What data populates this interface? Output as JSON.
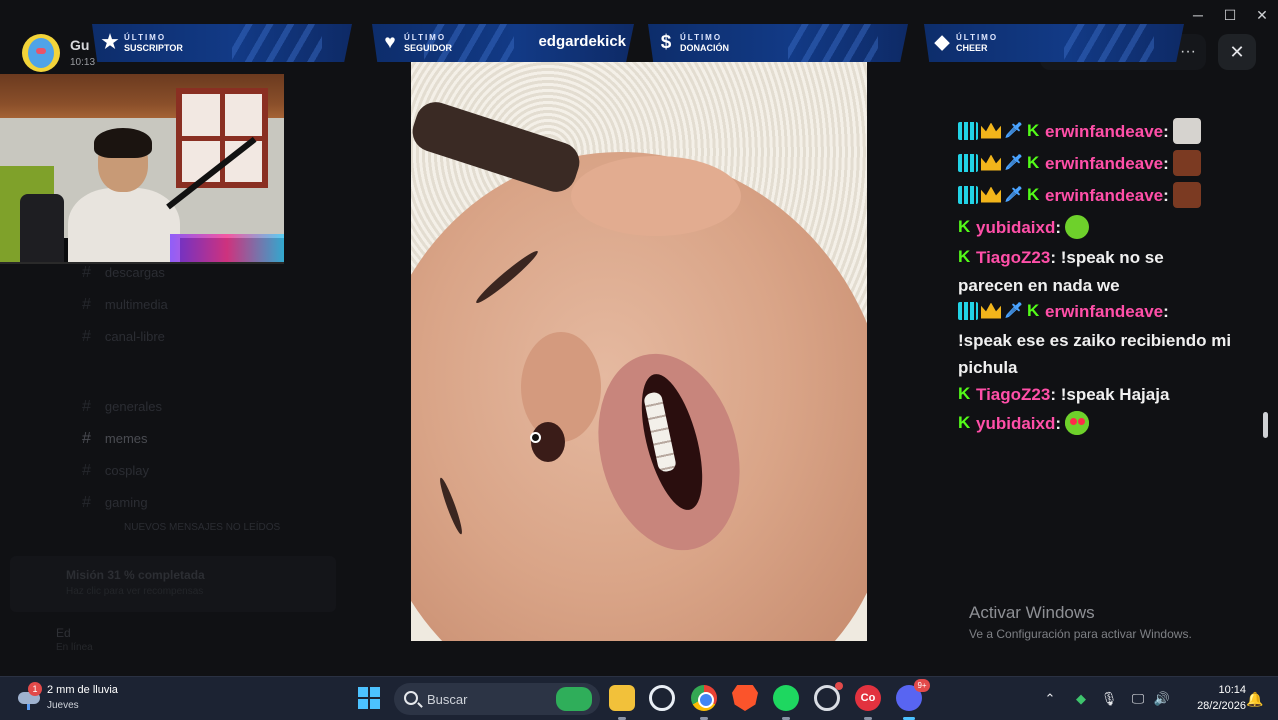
{
  "discord": {
    "server_name": "Gu",
    "server_time": "10:13",
    "channels": [
      {
        "label": "descargas"
      },
      {
        "label": "multimedia"
      },
      {
        "label": "canal-libre"
      },
      {
        "label": "generales"
      },
      {
        "label": "memes"
      },
      {
        "label": "cosplay"
      },
      {
        "label": "gaming"
      }
    ],
    "unread_label": "NUEVOS MENSAJES NO LEÍDOS",
    "mission_title": "Misión 31 % completada",
    "mission_sub": "Haz clic para ver recompensas",
    "user_name": "Ed",
    "user_status": "En línea"
  },
  "overlay": {
    "banners": [
      {
        "icon": "star-icon",
        "line1": "ÚLTIMO",
        "line2": "SUSCRIPTOR",
        "value": ""
      },
      {
        "icon": "heart-icon",
        "line1": "ÚLTIMO",
        "line2": "SEGUIDOR",
        "value": "edgardekick"
      },
      {
        "icon": "dollar-icon",
        "line1": "ÚLTIMO",
        "line2": "DONACIÓN",
        "value": ""
      },
      {
        "icon": "diamond-icon",
        "line1": "ÚLTIMO",
        "line2": "CHEER",
        "value": ""
      }
    ]
  },
  "viewer": {
    "more_label": "···",
    "close_label": "✕"
  },
  "chat": {
    "messages": [
      {
        "user": "erwinfandeave",
        "text": "",
        "emote": "cat-emote"
      },
      {
        "user": "erwinfandeave",
        "text": "",
        "emote": "man-emote"
      },
      {
        "user": "erwinfandeave",
        "text": "",
        "emote": "man-emote"
      },
      {
        "user": "yubidaixd",
        "text": "",
        "emote": "smile-emote"
      },
      {
        "user": "TiagoZ23",
        "text": "!speak no se",
        "text2": "parecen en nada we"
      },
      {
        "user": "erwinfandeave",
        "text": "",
        "text2": "!speak ese es zaiko recibiendo mi",
        "text3": "pichula"
      },
      {
        "user": "TiagoZ23",
        "text": "!speak Hajaja"
      },
      {
        "user": "yubidaixd",
        "text": "",
        "emote": "love-emote"
      }
    ],
    "colors": {
      "username": "#ff4fa8",
      "kick": "#53fc18",
      "text": "#f0f0f0"
    }
  },
  "watermark": {
    "title": "Activar Windows",
    "subtitle": "Ve a Configuración para activar Windows."
  },
  "taskbar": {
    "weather_count": "1",
    "weather_line1": "2 mm de lluvia",
    "weather_line2": "Jueves",
    "search_placeholder": "Buscar",
    "discord_badge": "9+",
    "co_label": "Co",
    "time": "10:14",
    "date": "28/2/2026"
  }
}
